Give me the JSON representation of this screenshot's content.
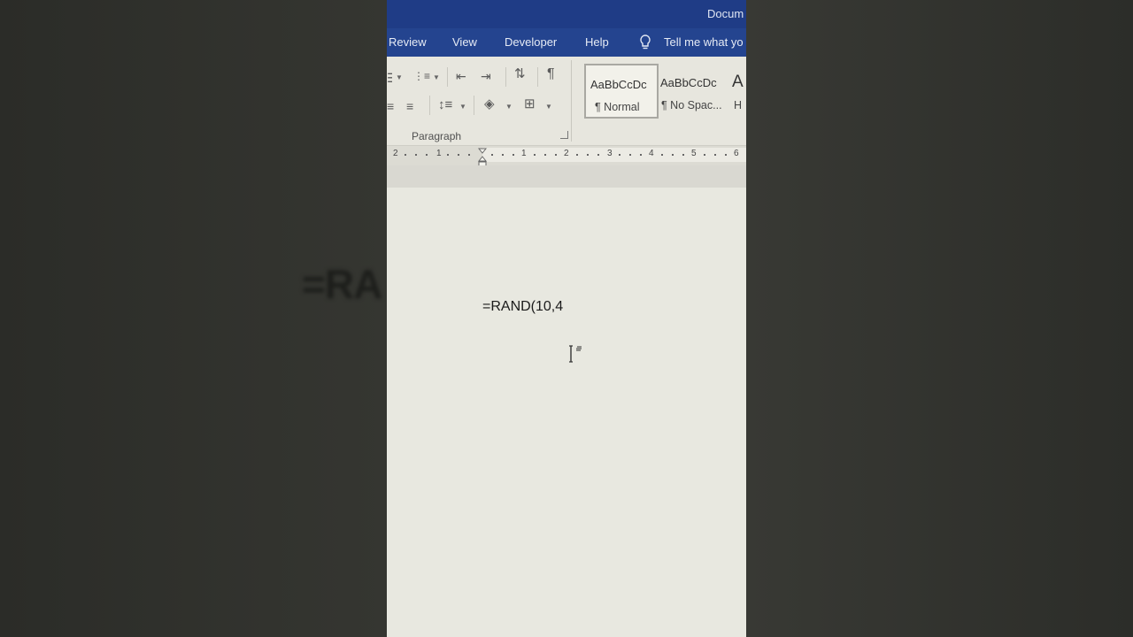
{
  "background": {
    "ghost_text": "=RA"
  },
  "window": {
    "title": "Docum"
  },
  "ribbon_tabs": [
    "Review",
    "View",
    "Developer",
    "Help"
  ],
  "tell_me": "Tell me what yo",
  "paragraph_group": {
    "label": "Paragraph",
    "icons": [
      "bullets-icon",
      "multilevel-list-icon",
      "decrease-indent-icon",
      "increase-indent-icon",
      "sort-icon",
      "show-formatting-icon",
      "align-justify-icon",
      "align-left-icon",
      "line-spacing-icon",
      "shading-icon",
      "borders-icon"
    ]
  },
  "styles_gallery": [
    {
      "sample": "AaBbCcDc",
      "name": "¶ Normal",
      "selected": true
    },
    {
      "sample": "AaBbCcDc",
      "name": "¶ No Spac...",
      "selected": false
    },
    {
      "sample": "A",
      "name": "H",
      "selected": false
    }
  ],
  "ruler": {
    "labels": [
      "2",
      "1",
      "1",
      "2",
      "3",
      "4",
      "5",
      "6"
    ]
  },
  "document": {
    "text": "=RAND(10,4"
  },
  "colors": {
    "title_bar": "#1f3c86",
    "tab_bar": "#24448f",
    "page": "#e8e8e0"
  }
}
